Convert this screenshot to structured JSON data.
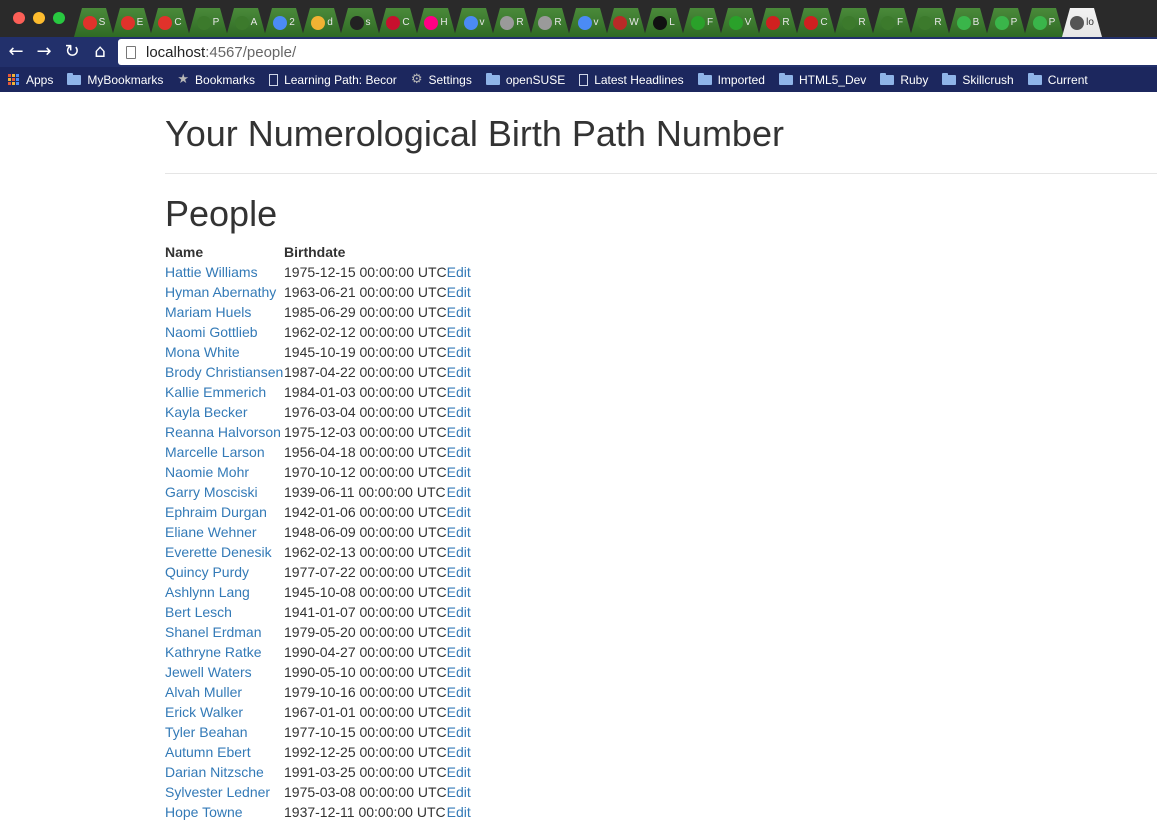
{
  "browser": {
    "tabs": [
      {
        "icon": "red-circle-icon",
        "label": "S",
        "color": "#e0322b"
      },
      {
        "icon": "red-circle-icon",
        "label": "E",
        "color": "#e0322b"
      },
      {
        "icon": "red-circle-icon",
        "label": "C",
        "color": "#e0322b"
      },
      {
        "icon": "green-square-icon",
        "label": "P",
        "color": "#3c7a2c"
      },
      {
        "icon": "green-square-icon",
        "label": "A",
        "color": "#3c7a2c"
      },
      {
        "icon": "calendar-icon",
        "label": "2",
        "color": "#4b8bf5"
      },
      {
        "icon": "google-drive-icon",
        "label": "d",
        "color": "#f2b233"
      },
      {
        "icon": "github-icon",
        "label": "s",
        "color": "#222222"
      },
      {
        "icon": "codeschool-icon",
        "label": "C",
        "color": "#c8102e"
      },
      {
        "icon": "flickr-icon",
        "label": "H",
        "color": "#ff0084"
      },
      {
        "icon": "google-icon",
        "label": "v",
        "color": "#4b8bf5"
      },
      {
        "icon": "ruby-gem-icon",
        "label": "R",
        "color": "#9a9a9a"
      },
      {
        "icon": "ruby-gem-icon",
        "label": "R",
        "color": "#9a9a9a"
      },
      {
        "icon": "google-icon",
        "label": "v",
        "color": "#4b8bf5"
      },
      {
        "icon": "quora-icon",
        "label": "W",
        "color": "#b92b27"
      },
      {
        "icon": "gl-icon",
        "label": "L",
        "color": "#111111"
      },
      {
        "icon": "terminal-icon",
        "label": "F",
        "color": "#2aa12a"
      },
      {
        "icon": "terminal-icon",
        "label": "V",
        "color": "#2aa12a"
      },
      {
        "icon": "rp-icon",
        "label": "R",
        "color": "#d02020"
      },
      {
        "icon": "rp-icon",
        "label": "C",
        "color": "#d02020"
      },
      {
        "icon": "green-square-icon",
        "label": "R",
        "color": "#3c7a2c"
      },
      {
        "icon": "green-square-icon",
        "label": "F",
        "color": "#3c7a2c"
      },
      {
        "icon": "green-square-icon",
        "label": "R",
        "color": "#3c7a2c"
      },
      {
        "icon": "udacity-icon",
        "label": "B",
        "color": "#3ab54a"
      },
      {
        "icon": "udacity-icon",
        "label": "P",
        "color": "#3ab54a"
      },
      {
        "icon": "udacity-icon",
        "label": "P",
        "color": "#3ab54a"
      },
      {
        "icon": "person-icon",
        "label": "lo",
        "color": "#555555",
        "active": true
      }
    ],
    "toolbar": {
      "back_glyph": "←",
      "forward_glyph": "→",
      "reload_glyph": "↻",
      "home_glyph": "⌂"
    },
    "address": {
      "host": "localhost",
      "path": ":4567/people/"
    },
    "bookmarks": [
      {
        "label": "Apps",
        "icon": "apps-grid-icon"
      },
      {
        "label": "MyBookmarks",
        "icon": "folder-icon"
      },
      {
        "label": "Bookmarks",
        "icon": "star-icon"
      },
      {
        "label": "Learning Path: Becor",
        "icon": "page-icon"
      },
      {
        "label": "Settings",
        "icon": "gear-icon"
      },
      {
        "label": "openSUSE",
        "icon": "folder-icon"
      },
      {
        "label": "Latest Headlines",
        "icon": "page-icon"
      },
      {
        "label": "Imported",
        "icon": "folder-icon"
      },
      {
        "label": "HTML5_Dev",
        "icon": "folder-icon"
      },
      {
        "label": "Ruby",
        "icon": "folder-icon"
      },
      {
        "label": "Skillcrush",
        "icon": "folder-icon"
      },
      {
        "label": "Current",
        "icon": "folder-icon"
      }
    ]
  },
  "page": {
    "title": "Your Numerological Birth Path Number",
    "section_title": "People",
    "table": {
      "headers": {
        "name": "Name",
        "birthdate": "Birthdate"
      },
      "edit_label": "Edit",
      "rows": [
        {
          "name": "Hattie Williams",
          "birthdate": "1975-12-15 00:00:00 UTC"
        },
        {
          "name": "Hyman Abernathy",
          "birthdate": "1963-06-21 00:00:00 UTC"
        },
        {
          "name": "Mariam Huels",
          "birthdate": "1985-06-29 00:00:00 UTC"
        },
        {
          "name": "Naomi Gottlieb",
          "birthdate": "1962-02-12 00:00:00 UTC"
        },
        {
          "name": "Mona White",
          "birthdate": "1945-10-19 00:00:00 UTC"
        },
        {
          "name": "Brody Christiansen",
          "birthdate": "1987-04-22 00:00:00 UTC"
        },
        {
          "name": "Kallie Emmerich",
          "birthdate": "1984-01-03 00:00:00 UTC"
        },
        {
          "name": "Kayla Becker",
          "birthdate": "1976-03-04 00:00:00 UTC"
        },
        {
          "name": "Reanna Halvorson",
          "birthdate": "1975-12-03 00:00:00 UTC"
        },
        {
          "name": "Marcelle Larson",
          "birthdate": "1956-04-18 00:00:00 UTC"
        },
        {
          "name": "Naomie Mohr",
          "birthdate": "1970-10-12 00:00:00 UTC"
        },
        {
          "name": "Garry Mosciski",
          "birthdate": "1939-06-11 00:00:00 UTC"
        },
        {
          "name": "Ephraim Durgan",
          "birthdate": "1942-01-06 00:00:00 UTC"
        },
        {
          "name": "Eliane Wehner",
          "birthdate": "1948-06-09 00:00:00 UTC"
        },
        {
          "name": "Everette Denesik",
          "birthdate": "1962-02-13 00:00:00 UTC"
        },
        {
          "name": "Quincy Purdy",
          "birthdate": "1977-07-22 00:00:00 UTC"
        },
        {
          "name": "Ashlynn Lang",
          "birthdate": "1945-10-08 00:00:00 UTC"
        },
        {
          "name": "Bert Lesch",
          "birthdate": "1941-01-07 00:00:00 UTC"
        },
        {
          "name": "Shanel Erdman",
          "birthdate": "1979-05-20 00:00:00 UTC"
        },
        {
          "name": "Kathryne Ratke",
          "birthdate": "1990-04-27 00:00:00 UTC"
        },
        {
          "name": "Jewell Waters",
          "birthdate": "1990-05-10 00:00:00 UTC"
        },
        {
          "name": "Alvah Muller",
          "birthdate": "1979-10-16 00:00:00 UTC"
        },
        {
          "name": "Erick Walker",
          "birthdate": "1967-01-01 00:00:00 UTC"
        },
        {
          "name": "Tyler Beahan",
          "birthdate": "1977-10-15 00:00:00 UTC"
        },
        {
          "name": "Autumn Ebert",
          "birthdate": "1992-12-25 00:00:00 UTC"
        },
        {
          "name": "Darian Nitzsche",
          "birthdate": "1991-03-25 00:00:00 UTC"
        },
        {
          "name": "Sylvester Ledner",
          "birthdate": "1975-03-08 00:00:00 UTC"
        },
        {
          "name": "Hope Towne",
          "birthdate": "1937-12-11 00:00:00 UTC"
        }
      ]
    }
  }
}
